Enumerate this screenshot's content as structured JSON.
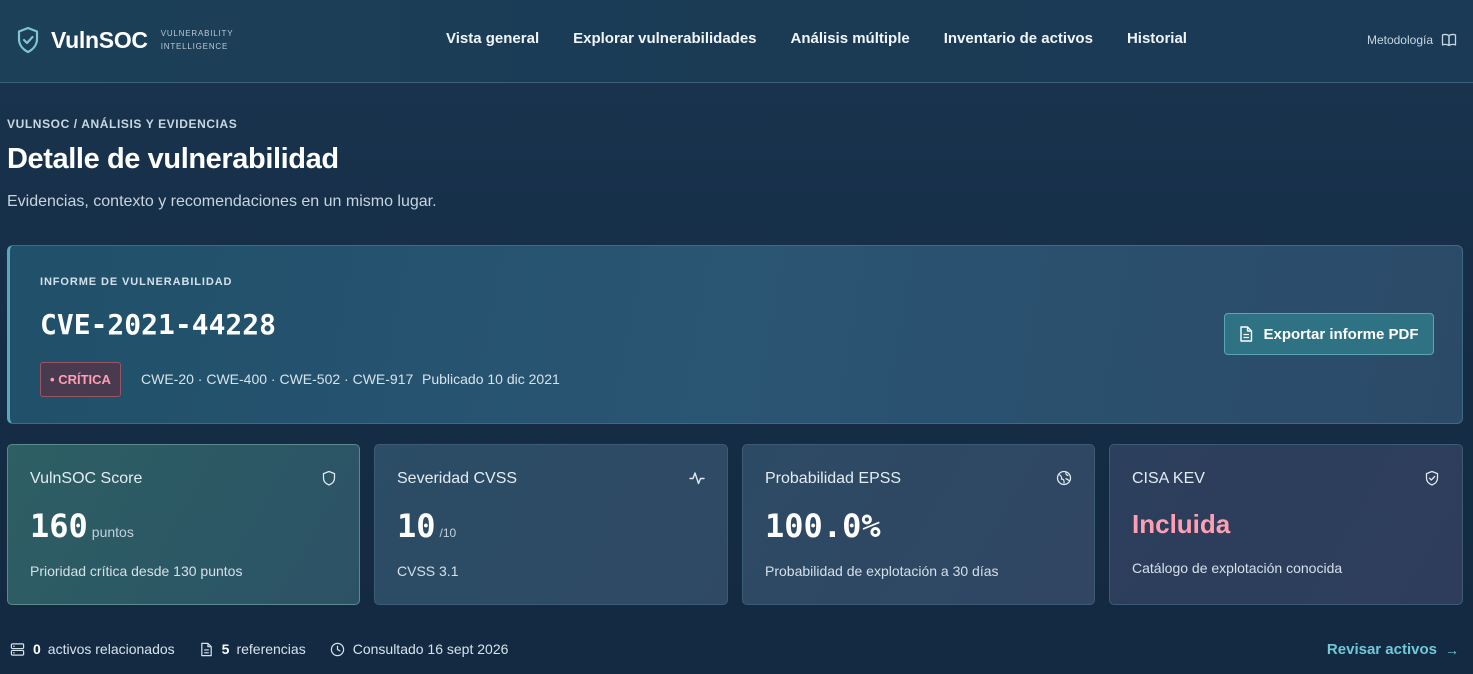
{
  "header": {
    "brand_name": "VulnSOC",
    "brand_tagline_1": "VULNERABILITY",
    "brand_tagline_2": "INTELLIGENCE",
    "nav": [
      {
        "label": "Vista general"
      },
      {
        "label": "Explorar vulnerabilidades"
      },
      {
        "label": "Análisis múltiple"
      },
      {
        "label": "Inventario de activos"
      },
      {
        "label": "Historial"
      }
    ],
    "methodology_label": "Metodología"
  },
  "page": {
    "breadcrumb": "VULNSOC / ANÁLISIS Y EVIDENCIAS",
    "title": "Detalle de vulnerabilidad",
    "subtitle": "Evidencias, contexto y recomendaciones en un mismo lugar."
  },
  "report": {
    "label": "INFORME DE VULNERABILIDAD",
    "cve_id": "CVE-2021-44228",
    "severity": "• CRÍTICA",
    "cwes": "CWE-20 · CWE-400 · CWE-502 · CWE-917",
    "published": "Publicado 10 dic 2021",
    "export_label": "Exportar informe PDF"
  },
  "metrics": {
    "score": {
      "title": "VulnSOC Score",
      "value": "160",
      "unit": "puntos",
      "desc": "Prioridad crítica desde 130 puntos",
      "icon": "shield-icon"
    },
    "cvss": {
      "title": "Severidad CVSS",
      "value": "10",
      "unit": "/10",
      "desc": "CVSS 3.1",
      "icon": "activity-icon"
    },
    "epss": {
      "title": "Probabilidad EPSS",
      "value": "100.0%",
      "desc": "Probabilidad de explotación a 30 días",
      "icon": "globe-icon"
    },
    "kev": {
      "title": "CISA KEV",
      "value": "Incluida",
      "desc": "Catálogo de explotación conocida",
      "icon": "shield-check-icon"
    }
  },
  "footer": {
    "assets_count": "0",
    "assets_label": "activos relacionados",
    "refs_count": "5",
    "refs_label": "referencias",
    "consulted": "Consultado 16 sept 2026",
    "review_label": "Revisar activos",
    "review_arrow": "→"
  },
  "colors": {
    "accent": "#6fc9d6",
    "critical": "#ff9fb2",
    "export_button": "#2f7283"
  }
}
